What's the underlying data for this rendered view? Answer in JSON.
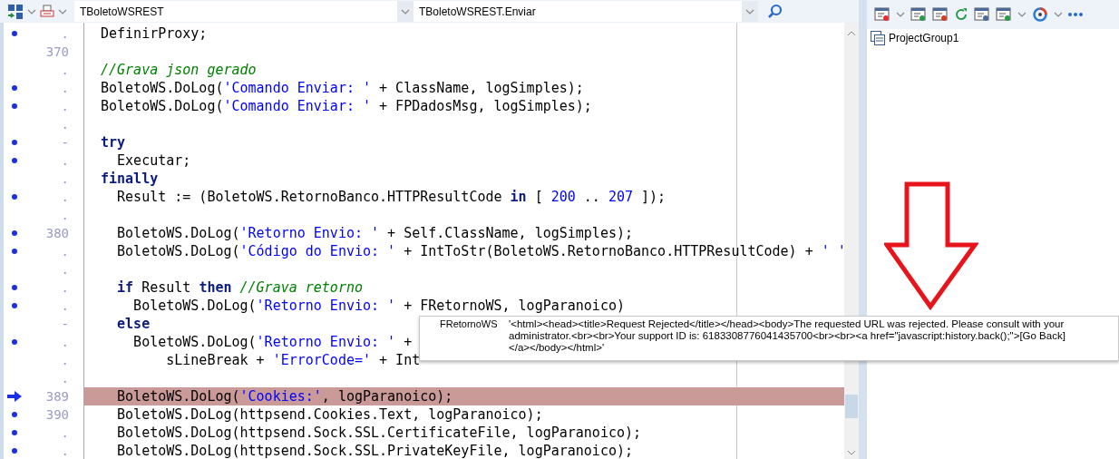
{
  "editor_toolbar": {
    "unit_selector": {
      "value": "TBoletoWSREST"
    },
    "method_selector": {
      "value": "TBoletoWSREST.Enviar"
    }
  },
  "code_lines": [
    {
      "breakpoint": true,
      "label": ".",
      "current": false,
      "tokens": [
        {
          "kind": "plain",
          "t": "DefinirProxy;"
        }
      ]
    },
    {
      "breakpoint": false,
      "label": "370",
      "current": false
    },
    {
      "breakpoint": false,
      "label": ".",
      "current": false,
      "tokens": [
        {
          "kind": "comment",
          "t": "//Grava json gerado"
        }
      ]
    },
    {
      "breakpoint": true,
      "label": ".",
      "current": false,
      "tokens": [
        {
          "kind": "plain",
          "t": "BoletoWS.DoLog("
        },
        {
          "kind": "string",
          "t": "'Comando Enviar: '"
        },
        {
          "kind": "plain",
          "t": " + ClassName, logSimples);"
        }
      ]
    },
    {
      "breakpoint": true,
      "label": ".",
      "current": false,
      "tokens": [
        {
          "kind": "plain",
          "t": "BoletoWS.DoLog("
        },
        {
          "kind": "string",
          "t": "'Comando Enviar: '"
        },
        {
          "kind": "plain",
          "t": " + FPDadosMsg, logSimples);"
        }
      ]
    },
    {
      "breakpoint": false,
      "label": ".",
      "current": false
    },
    {
      "breakpoint": true,
      "label": "-",
      "current": false,
      "tokens": [
        {
          "kind": "keyword",
          "t": "try"
        }
      ]
    },
    {
      "breakpoint": true,
      "label": ".",
      "current": false,
      "tokens": [
        {
          "kind": "plain",
          "t": "  Executar;"
        }
      ]
    },
    {
      "breakpoint": false,
      "label": ".",
      "current": false,
      "tokens": [
        {
          "kind": "keyword",
          "t": "finally"
        }
      ]
    },
    {
      "breakpoint": true,
      "label": ".",
      "current": false,
      "tokens": [
        {
          "kind": "plain",
          "t": "  Result := (BoletoWS.RetornoBanco.HTTPResultCode "
        },
        {
          "kind": "keyword",
          "t": "in"
        },
        {
          "kind": "plain",
          "t": " [ "
        },
        {
          "kind": "number",
          "t": "200"
        },
        {
          "kind": "plain",
          "t": " .. "
        },
        {
          "kind": "number",
          "t": "207"
        },
        {
          "kind": "plain",
          "t": " ]);"
        }
      ]
    },
    {
      "breakpoint": false,
      "label": ".",
      "current": false
    },
    {
      "breakpoint": true,
      "label": "380",
      "current": false,
      "tokens": [
        {
          "kind": "plain",
          "t": "  BoletoWS.DoLog("
        },
        {
          "kind": "string",
          "t": "'Retorno Envio: '"
        },
        {
          "kind": "plain",
          "t": " + Self.ClassName, logSimples);"
        }
      ]
    },
    {
      "breakpoint": true,
      "label": ".",
      "current": false,
      "tokens": [
        {
          "kind": "plain",
          "t": "  BoletoWS.DoLog("
        },
        {
          "kind": "string",
          "t": "'Código do Envio: '"
        },
        {
          "kind": "plain",
          "t": " + IntToStr(BoletoWS.RetornoBanco.HTTPResultCode) + "
        },
        {
          "kind": "string",
          "t": "' '"
        }
      ]
    },
    {
      "breakpoint": false,
      "label": ".",
      "current": false
    },
    {
      "breakpoint": true,
      "label": ".",
      "current": false,
      "tokens": [
        {
          "kind": "keyword",
          "t": "  if"
        },
        {
          "kind": "plain",
          "t": " Result "
        },
        {
          "kind": "keyword",
          "t": "then"
        },
        {
          "kind": "comment",
          "t": " //Grava retorno"
        }
      ]
    },
    {
      "breakpoint": true,
      "label": ".",
      "current": false,
      "tokens": [
        {
          "kind": "plain",
          "t": "    BoletoWS.DoLog("
        },
        {
          "kind": "string",
          "t": "'Retorno Envio: '"
        },
        {
          "kind": "plain",
          "t": " + FRetornoWS, logParanoico)"
        }
      ]
    },
    {
      "breakpoint": false,
      "label": "-",
      "current": false,
      "tokens": [
        {
          "kind": "keyword",
          "t": "  else"
        }
      ]
    },
    {
      "breakpoint": true,
      "label": ".",
      "current": false,
      "tokens": [
        {
          "kind": "plain",
          "t": "    BoletoWS.DoLog("
        },
        {
          "kind": "string",
          "t": "'Retorno Envio: '"
        },
        {
          "kind": "plain",
          "t": " +"
        }
      ]
    },
    {
      "breakpoint": false,
      "label": ".",
      "current": false,
      "tokens": [
        {
          "kind": "plain",
          "t": "        sLineBreak + "
        },
        {
          "kind": "string",
          "t": "'ErrorCode='"
        },
        {
          "kind": "plain",
          "t": " + Int"
        }
      ]
    },
    {
      "breakpoint": false,
      "label": ".",
      "current": false
    },
    {
      "breakpoint": false,
      "label": "389",
      "current": true,
      "tokens": [
        {
          "kind": "plain",
          "t": "  BoletoWS.DoLog("
        },
        {
          "kind": "string",
          "t": "'Cookies:'"
        },
        {
          "kind": "plain",
          "t": ", logParanoico);"
        }
      ]
    },
    {
      "breakpoint": true,
      "label": "390",
      "current": false,
      "tokens": [
        {
          "kind": "plain",
          "t": "  BoletoWS.DoLog(httpsend.Cookies.Text, logParanoico);"
        }
      ]
    },
    {
      "breakpoint": true,
      "label": ".",
      "current": false,
      "tokens": [
        {
          "kind": "plain",
          "t": "  BoletoWS.DoLog(httpsend.Sock.SSL.CertificateFile, logParanoico);"
        }
      ]
    },
    {
      "breakpoint": true,
      "label": ".",
      "current": false,
      "tokens": [
        {
          "kind": "plain",
          "t": "  BoletoWS.DoLog(httpsend.Sock.SSL.PrivateKeyFile, logParanoico);"
        }
      ]
    }
  ],
  "tooltip": {
    "name": "FRetornoWS",
    "value": "'<html><head><title>Request Rejected</title></head><body>The requested URL was rejected. Please consult with your administrator.<br><br>Your support ID is: 6183308776041435700<br><br><a href=\"javascript:history.back();\">[Go Back]</a></body></html>'"
  },
  "project_manager": {
    "root": "ProjectGroup1"
  }
}
